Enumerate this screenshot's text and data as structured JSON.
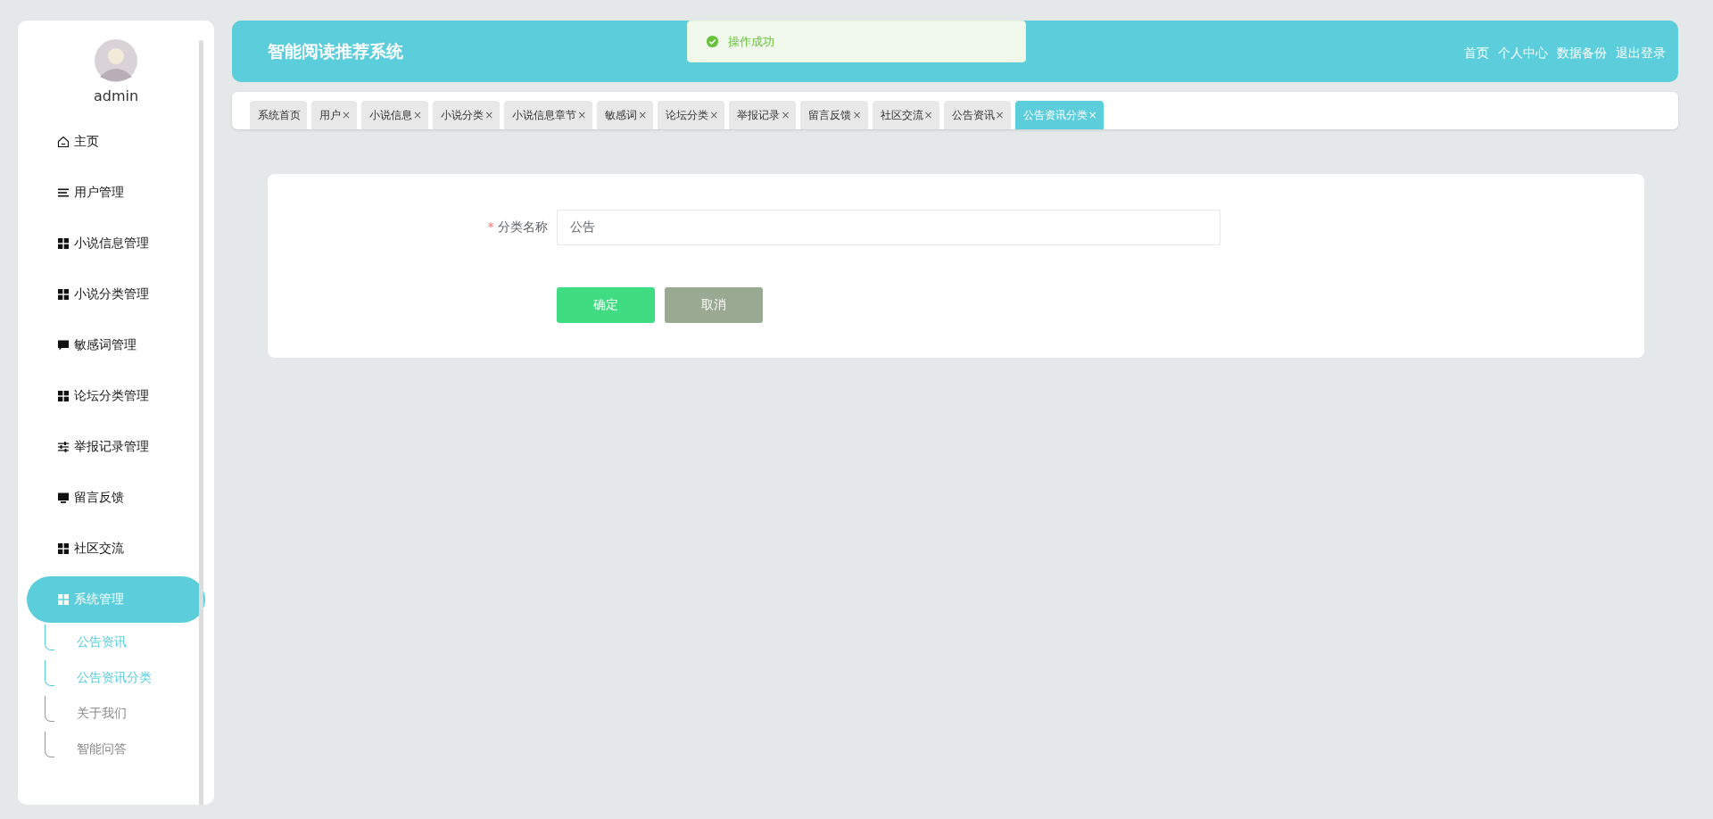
{
  "sidebar": {
    "user": "admin",
    "items": [
      {
        "label": "主页",
        "kind": "home",
        "selected": false
      },
      {
        "label": "用户管理",
        "kind": "list",
        "selected": false
      },
      {
        "label": "小说信息管理",
        "kind": "grid",
        "selected": false
      },
      {
        "label": "小说分类管理",
        "kind": "grid",
        "selected": false
      },
      {
        "label": "敏感词管理",
        "kind": "chat",
        "selected": false
      },
      {
        "label": "论坛分类管理",
        "kind": "grid",
        "selected": false
      },
      {
        "label": "举报记录管理",
        "kind": "sliders",
        "selected": false
      },
      {
        "label": "留言反馈",
        "kind": "monitor",
        "selected": false
      },
      {
        "label": "社区交流",
        "kind": "grid",
        "selected": false
      },
      {
        "label": "系统管理",
        "kind": "grid",
        "selected": true,
        "children": [
          {
            "label": "公告资讯",
            "selected": true
          },
          {
            "label": "公告资讯分类",
            "selected": true
          },
          {
            "label": "关于我们",
            "selected": false
          },
          {
            "label": "智能问答",
            "selected": false
          }
        ]
      }
    ]
  },
  "header": {
    "title": "智能阅读推荐系统",
    "links": [
      "首页",
      "个人中心",
      "数据备份",
      "退出登录"
    ]
  },
  "toast": {
    "message": "操作成功"
  },
  "tabs": [
    {
      "label": "系统首页",
      "selected": false
    },
    {
      "label": "用户",
      "close": "×",
      "selected": false
    },
    {
      "label": "小说信息",
      "close": "×",
      "selected": false
    },
    {
      "label": "小说分类",
      "close": "×",
      "selected": false
    },
    {
      "label": "小说信息章节",
      "close": "×",
      "selected": false
    },
    {
      "label": "敏感词",
      "close": "×",
      "selected": false
    },
    {
      "label": "论坛分类",
      "close": "×",
      "selected": false
    },
    {
      "label": "举报记录",
      "close": "×",
      "selected": false
    },
    {
      "label": "留言反馈",
      "close": "×",
      "selected": false
    },
    {
      "label": "社区交流",
      "close": "×",
      "selected": false
    },
    {
      "label": "公告资讯",
      "close": "×",
      "selected": false
    },
    {
      "label": "公告资讯分类",
      "close": "×",
      "selected": true
    }
  ],
  "form": {
    "fields": [
      {
        "label": "分类名称",
        "required_mark": "*",
        "value": "公告"
      }
    ],
    "buttons": [
      {
        "label": "确定",
        "kind": "primary"
      },
      {
        "label": "取消",
        "kind": "cancel"
      }
    ]
  }
}
